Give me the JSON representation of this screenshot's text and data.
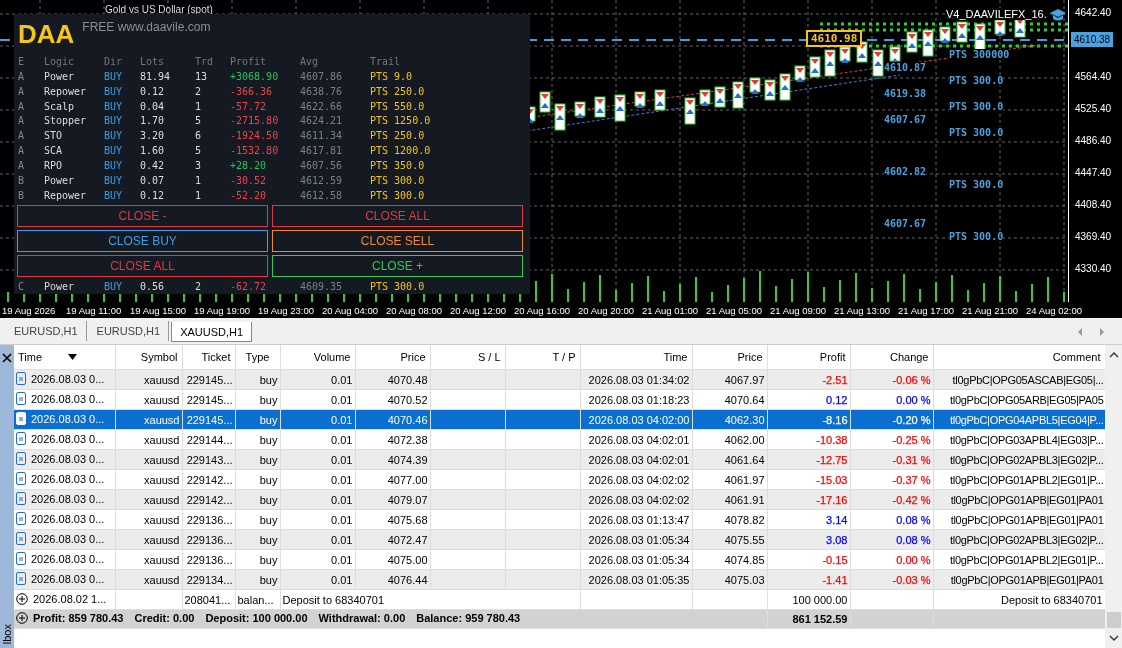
{
  "chart": {
    "symbol_title": "Gold vs US Dollar (spot)",
    "price_axis": [
      {
        "kind": "tick",
        "value": "4642.40"
      },
      {
        "kind": "current",
        "value": "4610.38"
      },
      {
        "kind": "tick",
        "value": "4564.40"
      },
      {
        "kind": "tick",
        "value": "4525.40"
      },
      {
        "kind": "tick",
        "value": "4486.40"
      },
      {
        "kind": "tick",
        "value": "4447.40"
      },
      {
        "kind": "tick",
        "value": "4408.40"
      },
      {
        "kind": "tick",
        "value": "4369.40"
      },
      {
        "kind": "tick",
        "value": "4330.40"
      }
    ],
    "time_axis": [
      "19 Aug 2026",
      "19 Aug 11:00",
      "19 Aug 15:00",
      "19 Aug 19:00",
      "19 Aug 23:00",
      "20 Aug 04:00",
      "20 Aug 08:00",
      "20 Aug 12:00",
      "20 Aug 16:00",
      "20 Aug 20:00",
      "21 Aug 01:00",
      "21 Aug 05:00",
      "21 Aug 09:00",
      "21 Aug 13:00",
      "21 Aug 17:00",
      "21 Aug 21:00",
      "24 Aug 02:00"
    ],
    "annotations": [
      {
        "kind": "title",
        "text": "V4_DAAVILEFX_16."
      },
      {
        "kind": "boxed",
        "text": "4610.98"
      },
      {
        "kind": "level",
        "text": "4610.87"
      },
      {
        "kind": "level",
        "text": "4619.38"
      },
      {
        "kind": "level",
        "text": "4607.67"
      },
      {
        "kind": "level",
        "text": "4602.82"
      },
      {
        "kind": "level",
        "text": "4607.67"
      },
      {
        "kind": "level",
        "text": "PTS 300000"
      },
      {
        "kind": "level",
        "text": "PTS 300.0"
      },
      {
        "kind": "level",
        "text": "PTS 300.0"
      },
      {
        "kind": "level",
        "text": "PTS 300.0"
      },
      {
        "kind": "level",
        "text": "PTS 300.0"
      },
      {
        "kind": "level",
        "text": "PTS 300.0"
      }
    ]
  },
  "panel": {
    "logo": "DAA",
    "watermark_text": "FREE www.daavile.com",
    "columns": [
      "E",
      "Logic",
      "Dir",
      "Lots",
      "Trd",
      "Profit",
      "Avg",
      "Trail"
    ],
    "rows": [
      {
        "e": "A",
        "logic": "Power",
        "dir": "BUY",
        "lots": "81.94",
        "trd": "13",
        "profit": "+3068.90",
        "color": "#22c55e",
        "avg": "4607.86",
        "trail": "PTS 9.0"
      },
      {
        "e": "A",
        "logic": "Repower",
        "dir": "BUY",
        "lots": "0.12",
        "trd": "2",
        "profit": "-366.36",
        "color": "#ef4444",
        "avg": "4638.76",
        "trail": "PTS 250.0"
      },
      {
        "e": "A",
        "logic": "Scalp",
        "dir": "BUY",
        "lots": "0.04",
        "trd": "1",
        "profit": "-57.72",
        "color": "#ef4444",
        "avg": "4622.66",
        "trail": "PTS 550.0"
      },
      {
        "e": "A",
        "logic": "Stopper",
        "dir": "BUY",
        "lots": "1.70",
        "trd": "5",
        "profit": "-2715.80",
        "color": "#ef4444",
        "avg": "4624.21",
        "trail": "PTS 1250.0"
      },
      {
        "e": "A",
        "logic": "STO",
        "dir": "BUY",
        "lots": "3.20",
        "trd": "6",
        "profit": "-1924.50",
        "color": "#ef4444",
        "avg": "4611.34",
        "trail": "PTS 250.0"
      },
      {
        "e": "A",
        "logic": "SCA",
        "dir": "BUY",
        "lots": "1.60",
        "trd": "5",
        "profit": "-1532.80",
        "color": "#ef4444",
        "avg": "4617.81",
        "trail": "PTS 1200.0"
      },
      {
        "e": "A",
        "logic": "RPO",
        "dir": "BUY",
        "lots": "0.42",
        "trd": "3",
        "profit": "+28.20",
        "color": "#22c55e",
        "avg": "4607.56",
        "trail": "PTS 350.0"
      },
      {
        "e": "B",
        "logic": "Power",
        "dir": "BUY",
        "lots": "0.07",
        "trd": "1",
        "profit": "-30.52",
        "color": "#ef4444",
        "avg": "4612.59",
        "trail": "PTS 300.0"
      },
      {
        "e": "B",
        "logic": "Repower",
        "dir": "BUY",
        "lots": "0.12",
        "trd": "1",
        "profit": "-52.20",
        "color": "#ef4444",
        "avg": "4612.58",
        "trail": "PTS 300.0"
      }
    ],
    "buttons": [
      {
        "label": "CLOSE -",
        "color": "#e0393e"
      },
      {
        "label": "CLOSE ALL",
        "color": "#e0393e"
      },
      {
        "label": "CLOSE BUY",
        "color": "#3aa0e8"
      },
      {
        "label": "CLOSE SELL",
        "color": "#f08a30"
      },
      {
        "label": "CLOSE ALL",
        "color": "#e0393e"
      },
      {
        "label": "CLOSE +",
        "color": "#2ecc55"
      }
    ],
    "after_rows": [
      {
        "e": "C",
        "logic": "Power",
        "dir": "BUY",
        "lots": "0.56",
        "trd": "2",
        "profit": "-62.72",
        "color": "#ef4444",
        "avg": "4609.35",
        "trail": "PTS 300.0"
      }
    ]
  },
  "chart_tabs": [
    {
      "label": "EURUSD,H1",
      "selected": false
    },
    {
      "label": "EURUSD,H1",
      "selected": false
    },
    {
      "label": "XAUUSD,H1",
      "selected": true
    }
  ],
  "toolbox": {
    "label": "lbox"
  },
  "table": {
    "columns": [
      "Time",
      "Symbol",
      "Ticket",
      "Type",
      "Volume",
      "Price",
      "S / L",
      "T / P",
      "Time",
      "Price",
      "Profit",
      "Change",
      "Comment"
    ],
    "rows": [
      {
        "kind": "trade",
        "selected": false,
        "time": "2026.08.03 0...",
        "symbol": "xauusd",
        "ticket": "229145...",
        "type": "buy",
        "volume": "0.01",
        "price": "4070.48",
        "close_time": "2026.08.03 01:34:02",
        "close_price": "4067.97",
        "profit": "-2.51",
        "change": "-0.06 %",
        "color": "#ff0000",
        "comment": "tl0gPbC|OPG05ASCAB|EG05|..."
      },
      {
        "kind": "trade",
        "selected": false,
        "time": "2026.08.03 0...",
        "symbol": "xauusd",
        "ticket": "229145...",
        "type": "buy",
        "volume": "0.01",
        "price": "4070.52",
        "close_time": "2026.08.03 01:18:23",
        "close_price": "4070.64",
        "profit": "0.12",
        "change": "0.00 %",
        "color": "#0000ff",
        "comment": "tl0gPbC|OPG05ARB|EG05|PA05"
      },
      {
        "kind": "trade",
        "selected": true,
        "time": "2026.08.03 0...",
        "symbol": "xauusd",
        "ticket": "229145...",
        "type": "buy",
        "volume": "0.01",
        "price": "4070.46",
        "close_time": "2026.08.03 04:02:00",
        "close_price": "4062.30",
        "profit": "-8.16",
        "change": "-0.20 %",
        "comment": "tl0gPbC|OPG04APBL5|EG04|P..."
      },
      {
        "kind": "trade",
        "selected": false,
        "time": "2026.08.03 0...",
        "symbol": "xauusd",
        "ticket": "229144...",
        "type": "buy",
        "volume": "0.01",
        "price": "4072.38",
        "close_time": "2026.08.03 04:02:01",
        "close_price": "4062.00",
        "profit": "-10.38",
        "change": "-0.25 %",
        "color": "#ff0000",
        "comment": "tl0gPbC|OPG03APBL4|EG03|P..."
      },
      {
        "kind": "trade",
        "selected": false,
        "time": "2026.08.03 0...",
        "symbol": "xauusd",
        "ticket": "229143...",
        "type": "buy",
        "volume": "0.01",
        "price": "4074.39",
        "close_time": "2026.08.03 04:02:01",
        "close_price": "4061.64",
        "profit": "-12.75",
        "change": "-0.31 %",
        "color": "#ff0000",
        "comment": "tl0gPbC|OPG02APBL3|EG02|P..."
      },
      {
        "kind": "trade",
        "selected": false,
        "time": "2026.08.03 0...",
        "symbol": "xauusd",
        "ticket": "229142...",
        "type": "buy",
        "volume": "0.01",
        "price": "4077.00",
        "close_time": "2026.08.03 04:02:02",
        "close_price": "4061.97",
        "profit": "-15.03",
        "change": "-0.37 %",
        "color": "#ff0000",
        "comment": "tl0gPbC|OPG01APBL2|EG01|P..."
      },
      {
        "kind": "trade",
        "selected": false,
        "time": "2026.08.03 0...",
        "symbol": "xauusd",
        "ticket": "229142...",
        "type": "buy",
        "volume": "0.01",
        "price": "4079.07",
        "close_time": "2026.08.03 04:02:02",
        "close_price": "4061.91",
        "profit": "-17.16",
        "change": "-0.42 %",
        "color": "#ff0000",
        "comment": "tl0gPbC|OPG01APB|EG01|PA01"
      },
      {
        "kind": "trade",
        "selected": false,
        "time": "2026.08.03 0...",
        "symbol": "xauusd",
        "ticket": "229136...",
        "type": "buy",
        "volume": "0.01",
        "price": "4075.68",
        "close_time": "2026.08.03 01:13:47",
        "close_price": "4078.82",
        "profit": "3.14",
        "change": "0.08 %",
        "color": "#0000ff",
        "comment": "tl0gPbC|OPG01APB|EG01|PA01"
      },
      {
        "kind": "trade",
        "selected": false,
        "time": "2026.08.03 0...",
        "symbol": "xauusd",
        "ticket": "229136...",
        "type": "buy",
        "volume": "0.01",
        "price": "4072.47",
        "close_time": "2026.08.03 01:05:34",
        "close_price": "4075.55",
        "profit": "3.08",
        "change": "0.08 %",
        "color": "#0000ff",
        "comment": "tl0gPbC|OPG02APBL3|EG02|P..."
      },
      {
        "kind": "trade",
        "selected": false,
        "time": "2026.08.03 0...",
        "symbol": "xauusd",
        "ticket": "229136...",
        "type": "buy",
        "volume": "0.01",
        "price": "4075.00",
        "close_time": "2026.08.03 01:05:34",
        "close_price": "4074.85",
        "profit": "-0.15",
        "change": "0.00 %",
        "color": "#ff0000",
        "comment": "tl0gPbC|OPG01APBL2|EG01|P..."
      },
      {
        "kind": "trade",
        "selected": false,
        "time": "2026.08.03 0...",
        "symbol": "xauusd",
        "ticket": "229134...",
        "type": "buy",
        "volume": "0.01",
        "price": "4076.44",
        "close_time": "2026.08.03 01:05:35",
        "close_price": "4075.03",
        "profit": "-1.41",
        "change": "-0.03 %",
        "color": "#ff0000",
        "comment": "tl0gPbC|OPG01APB|EG01|PA01"
      },
      {
        "kind": "balance",
        "selected": false,
        "time": "2026.08.02 1...",
        "ticket": "208041...",
        "type": "balan...",
        "note": "Deposit to 68340701",
        "profit": "100 000.00",
        "comment": "Deposit to 68340701"
      }
    ],
    "summary": [
      "Profit: 859 780.43",
      "Credit: 0.00",
      "Deposit: 100 000.00",
      "Withdrawal: 0.00",
      "Balance: 959 780.43"
    ],
    "total": "861 152.59"
  }
}
